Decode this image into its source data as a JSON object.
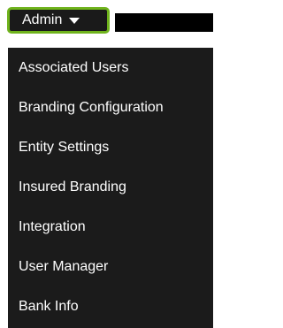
{
  "admin_menu": {
    "label": "Admin",
    "caret_icon": "caret-down-icon",
    "accent_color": "#6fb31c",
    "items": [
      {
        "label": "Associated Users"
      },
      {
        "label": "Branding Configuration"
      },
      {
        "label": "Entity Settings"
      },
      {
        "label": "Insured Branding"
      },
      {
        "label": "Integration"
      },
      {
        "label": "User Manager"
      },
      {
        "label": "Bank Info"
      }
    ]
  }
}
